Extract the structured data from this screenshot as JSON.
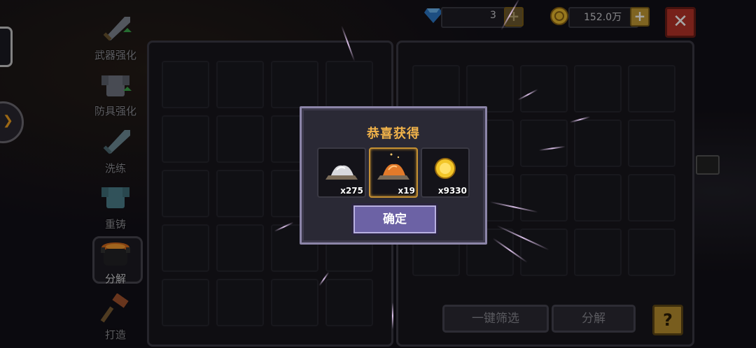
{
  "resources": {
    "gems": {
      "icon": "diamond-icon",
      "value": "3",
      "color": "#3a8ad6"
    },
    "coins": {
      "icon": "coin-icon",
      "value": "152.0万",
      "color": "#e8b92e"
    }
  },
  "close_icon": "close-icon",
  "close_glyph": "✕",
  "plus_glyph": "+",
  "left_arrow_glyph": "❯",
  "side_nav": [
    {
      "label": "武器强化",
      "icon": "sword-upgrade-icon"
    },
    {
      "label": "防具强化",
      "icon": "armor-upgrade-icon"
    },
    {
      "label": "洗练",
      "icon": "sword-refine-icon"
    },
    {
      "label": "重铸",
      "icon": "armor-recast-icon"
    },
    {
      "label": "分解",
      "icon": "cauldron-icon",
      "active": true
    },
    {
      "label": "打造",
      "icon": "hammer-forge-icon"
    }
  ],
  "buttons": {
    "filter": "一键筛选",
    "decompose": "分解",
    "help": "?"
  },
  "modal": {
    "title": "恭喜获得",
    "rewards": [
      {
        "icon": "white-dust-icon",
        "qty": "x275",
        "selected": false
      },
      {
        "icon": "orange-dust-icon",
        "qty": "x19",
        "selected": true
      },
      {
        "icon": "gold-coin-icon",
        "qty": "x9330",
        "selected": false
      }
    ],
    "confirm": "确定"
  },
  "colors": {
    "title_gold": "#f0b24a",
    "confirm_purple": "#6c62a5",
    "close_red": "#b73328",
    "accent_gold": "#c49a34"
  }
}
